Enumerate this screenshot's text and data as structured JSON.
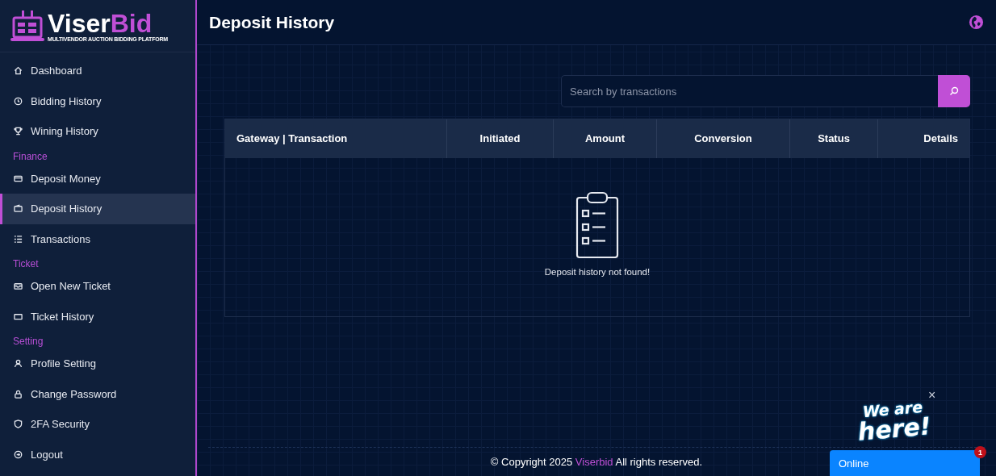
{
  "brand": {
    "name_first": "Viser",
    "name_second": "Bid",
    "tagline": "MULTIVENDOR AUCTION BIDDING PLATFORM"
  },
  "sidebar": {
    "groups": [
      {
        "items": [
          {
            "label": "Dashboard",
            "selected": false
          },
          {
            "label": "Bidding History",
            "selected": false
          },
          {
            "label": "Wining History",
            "selected": false
          }
        ]
      },
      {
        "title": "Finance",
        "items": [
          {
            "label": "Deposit Money",
            "selected": false
          },
          {
            "label": "Deposit History",
            "selected": true
          },
          {
            "label": "Transactions",
            "selected": false
          }
        ]
      },
      {
        "title": "Ticket",
        "items": [
          {
            "label": "Open New Ticket",
            "selected": false
          },
          {
            "label": "Ticket History",
            "selected": false
          }
        ]
      },
      {
        "title": "Setting",
        "items": [
          {
            "label": "Profile Setting",
            "selected": false
          },
          {
            "label": "Change Password",
            "selected": false
          },
          {
            "label": "2FA Security",
            "selected": false
          },
          {
            "label": "Logout",
            "selected": false
          }
        ]
      }
    ]
  },
  "page": {
    "title": "Deposit History"
  },
  "search": {
    "placeholder": "Search by transactions"
  },
  "table": {
    "columns": [
      "Gateway | Transaction",
      "Initiated",
      "Amount",
      "Conversion",
      "Status",
      "Details"
    ],
    "empty_message": "Deposit history not found!"
  },
  "footer": {
    "before": "© Copyright 2025",
    "link": "Viserbid",
    "after": "All rights reserved."
  },
  "chat": {
    "greeting_top": "We are",
    "greeting_bottom": "here!",
    "close": "×",
    "status": "Online",
    "badge": "1"
  }
}
